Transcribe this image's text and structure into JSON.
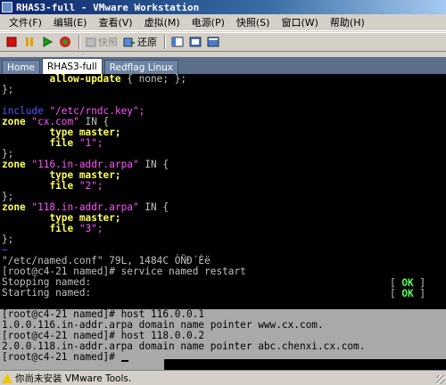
{
  "window": {
    "title": "RHAS3-full - VMware Workstation"
  },
  "menu": [
    {
      "label": "文件(F)",
      "name": "menu-file"
    },
    {
      "label": "编辑(E)",
      "name": "menu-edit"
    },
    {
      "label": "查看(V)",
      "name": "menu-view"
    },
    {
      "label": "虚拟(M)",
      "name": "menu-vm"
    },
    {
      "label": "电源(P)",
      "name": "menu-power"
    },
    {
      "label": "快照(S)",
      "name": "menu-snapshot"
    },
    {
      "label": "窗口(W)",
      "name": "menu-window"
    },
    {
      "label": "帮助(H)",
      "name": "menu-help"
    }
  ],
  "toolbar": {
    "snapshot_label": "快照",
    "revert_label": "还原",
    "colors": {
      "stop": "#d01010",
      "pause": "#e0a000",
      "play": "#1a9a1a",
      "reset": "#d82020"
    }
  },
  "tabs": [
    {
      "label": "Home",
      "active": false
    },
    {
      "label": "RHAS3-full",
      "active": true
    },
    {
      "label": "Redflag Linux",
      "active": false
    }
  ],
  "console": {
    "upper": [
      [
        {
          "t": "        ",
          "c": "c-w"
        },
        {
          "t": "allow-update",
          "c": "c-y"
        },
        {
          "t": " { none; };",
          "c": "c-w"
        }
      ],
      [
        {
          "t": "};",
          "c": "c-w"
        }
      ],
      [
        {
          "t": "",
          "c": "c-w"
        }
      ],
      [
        {
          "t": "include",
          "c": "c-b"
        },
        {
          "t": " \"/etc/rndc.key\";",
          "c": "c-m"
        }
      ],
      [
        {
          "t": "zone",
          "c": "c-y"
        },
        {
          "t": " \"cx.com\"",
          "c": "c-m"
        },
        {
          "t": " IN {",
          "c": "c-w"
        }
      ],
      [
        {
          "t": "        ",
          "c": "c-w"
        },
        {
          "t": "type",
          "c": "c-y"
        },
        {
          "t": " master;",
          "c": "c-y"
        }
      ],
      [
        {
          "t": "        ",
          "c": "c-w"
        },
        {
          "t": "file",
          "c": "c-y"
        },
        {
          "t": " \"1\";",
          "c": "c-m"
        }
      ],
      [
        {
          "t": "};",
          "c": "c-w"
        }
      ],
      [
        {
          "t": "zone",
          "c": "c-y"
        },
        {
          "t": " \"116.in-addr.arpa\"",
          "c": "c-m"
        },
        {
          "t": " IN {",
          "c": "c-w"
        }
      ],
      [
        {
          "t": "        ",
          "c": "c-w"
        },
        {
          "t": "type",
          "c": "c-y"
        },
        {
          "t": " master;",
          "c": "c-y"
        }
      ],
      [
        {
          "t": "        ",
          "c": "c-w"
        },
        {
          "t": "file",
          "c": "c-y"
        },
        {
          "t": " \"2\";",
          "c": "c-m"
        }
      ],
      [
        {
          "t": "};",
          "c": "c-w"
        }
      ],
      [
        {
          "t": "zone",
          "c": "c-y"
        },
        {
          "t": " \"118.in-addr.arpa\"",
          "c": "c-m"
        },
        {
          "t": " IN {",
          "c": "c-w"
        }
      ],
      [
        {
          "t": "        ",
          "c": "c-w"
        },
        {
          "t": "type",
          "c": "c-y"
        },
        {
          "t": " master;",
          "c": "c-y"
        }
      ],
      [
        {
          "t": "        ",
          "c": "c-w"
        },
        {
          "t": "file",
          "c": "c-y"
        },
        {
          "t": " \"3\";",
          "c": "c-m"
        }
      ],
      [
        {
          "t": "};",
          "c": "c-w"
        }
      ],
      [
        {
          "t": "~",
          "c": "c-b"
        }
      ],
      [
        {
          "t": "\"/etc/named.conf\" 79L, 1484C ÒÑÐ´Èë",
          "c": "c-w"
        }
      ],
      [
        {
          "t": "[root@c4-21 named]# service named restart",
          "c": "c-w"
        }
      ],
      [
        {
          "t": "Stopping named: ",
          "c": "c-w"
        }
      ],
      [
        {
          "t": "Starting named: ",
          "c": "c-w"
        }
      ]
    ],
    "status_ok": [
      {
        "open": "[  ",
        "ok": "OK",
        "close": "  ]"
      },
      {
        "open": "[  ",
        "ok": "OK",
        "close": "  ]"
      }
    ],
    "lower": [
      "[root@c4-21 named]# host 116.0.0.1",
      "1.0.0.116.in-addr.arpa domain name pointer www.cx.com.",
      "[root@c4-21 named]# host 118.0.0.2",
      "2.0.0.118.in-addr.arpa domain name pointer abc.chenxi.cx.com.",
      "[root@c4-21 named]# "
    ]
  },
  "statusbar": {
    "message": "你尚未安装 VMware Tools."
  }
}
